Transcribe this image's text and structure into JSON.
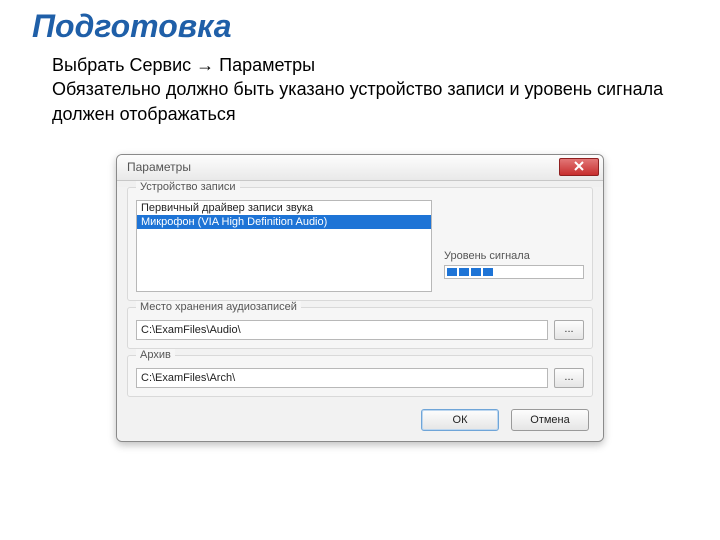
{
  "slide": {
    "title": "Подготовка",
    "line1": "Выбрать Сервис → Параметры",
    "line2": "Обязательно должно быть указано устройство записи и уровень сигнала должен отображаться"
  },
  "dialog": {
    "title": "Параметры",
    "group_device_label": "Устройство записи",
    "device_options": {
      "opt0": "Первичный драйвер записи звука",
      "opt1": "Микрофон (VIA High Definition Audio)"
    },
    "signal_label": "Уровень сигнала",
    "group_storage_label": "Место хранения аудиозаписей",
    "storage_path": "C:\\ExamFiles\\Audio\\",
    "group_archive_label": "Архив",
    "archive_path": "C:\\ExamFiles\\Arch\\",
    "browse_label": "...",
    "ok_label": "ОК",
    "cancel_label": "Отмена"
  }
}
